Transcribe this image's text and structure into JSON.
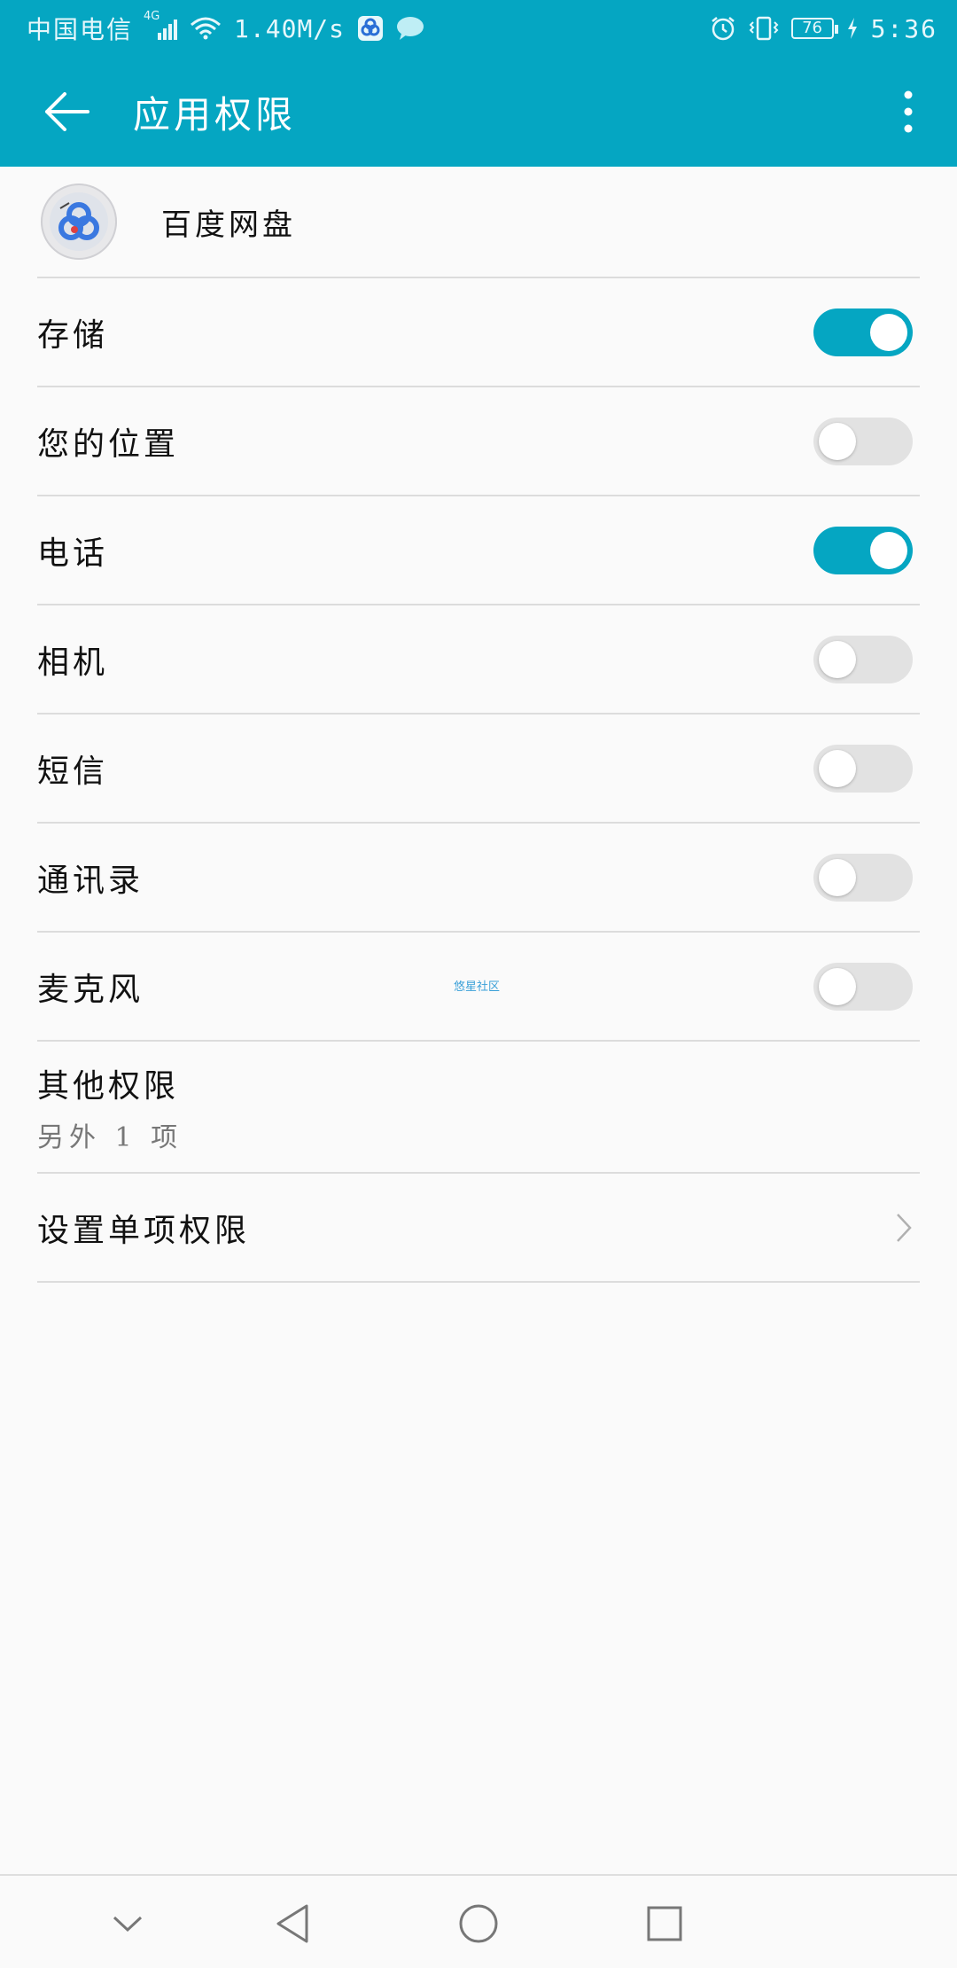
{
  "status_bar": {
    "carrier": "中国电信",
    "network": "4G",
    "speed": "1.40M/s",
    "battery": "76",
    "time": "5:36",
    "accent_color": "#05a6c2"
  },
  "app_bar": {
    "title": "应用权限",
    "back_icon": "arrow-left-icon",
    "more_icon": "more-vert-icon"
  },
  "app": {
    "name": "百度网盘",
    "icon": "baidu-netdisk-icon"
  },
  "permissions": [
    {
      "label": "存储",
      "enabled": true
    },
    {
      "label": "您的位置",
      "enabled": false
    },
    {
      "label": "电话",
      "enabled": true
    },
    {
      "label": "相机",
      "enabled": false
    },
    {
      "label": "短信",
      "enabled": false
    },
    {
      "label": "通讯录",
      "enabled": false
    },
    {
      "label": "麦克风",
      "enabled": false
    }
  ],
  "watermark": "悠星社区",
  "other_permissions": {
    "title": "其他权限",
    "subtitle": "另外 1 项"
  },
  "single_permission": {
    "label": "设置单项权限"
  },
  "nav_bar": {
    "items": [
      "chevron-down-icon",
      "back-triangle-icon",
      "home-circle-icon",
      "recents-square-icon"
    ]
  }
}
